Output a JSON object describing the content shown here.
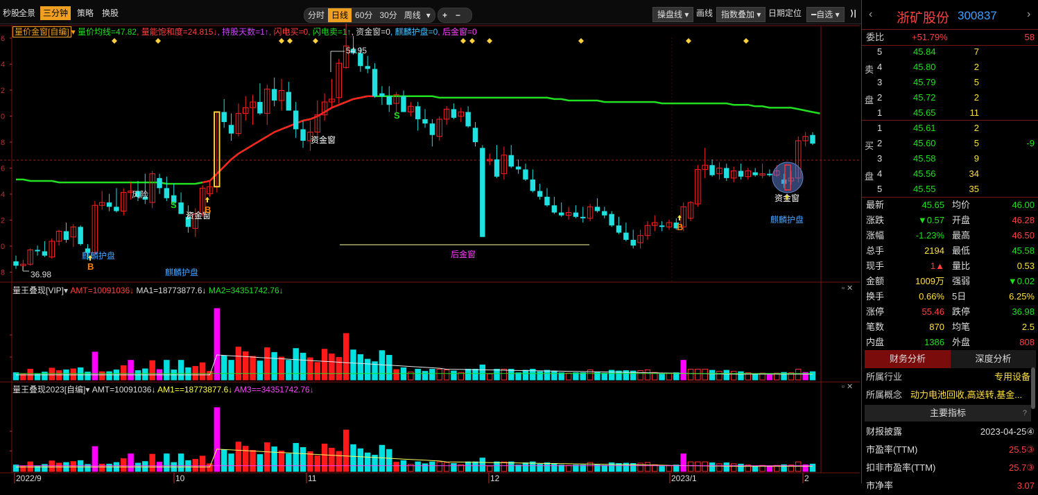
{
  "toolbar": {
    "left_items": [
      "秒股",
      "全景",
      "三分钟",
      "策略",
      "换股"
    ],
    "active_item": "三分钟",
    "periods": [
      "分时",
      "日线",
      "60分",
      "30分",
      "周线"
    ],
    "active_period": "日线",
    "period_dropdown_arrow": "▾",
    "plus": "+",
    "minus": "−",
    "right_items": [
      "操盘线",
      "画线",
      "指数叠加",
      "日期定位",
      "自选"
    ],
    "collapse_glyph": "⟩|"
  },
  "main_indicator": {
    "name": "量价金窗[自编]",
    "items": [
      {
        "text": "量价均线=47.82",
        "color": "#20e020"
      },
      {
        "text": "量能饱和度=24.815↓",
        "color": "#ff4040"
      },
      {
        "text": "持股天数=1↑",
        "color": "#d040ff"
      },
      {
        "text": "闪电买=0",
        "color": "#ff4040"
      },
      {
        "text": "闪电卖=1↑",
        "color": "#20e020"
      },
      {
        "text": "资金窗=0",
        "color": "#dddddd"
      },
      {
        "text": "麒麟护盘=0",
        "color": "#40c0ff"
      },
      {
        "text": "后金窗=0",
        "color": "#ff40ff"
      }
    ],
    "y_ticks": [
      "6",
      "4",
      "2",
      "0",
      "8",
      "6",
      "4",
      "2",
      "0",
      "8"
    ],
    "price_high": "54.95",
    "price_low": "36.98",
    "annotations": [
      {
        "text": "风险",
        "color": "#dddddd"
      },
      {
        "text": "资金窗",
        "color": "#ffffff"
      },
      {
        "text": "资金窗",
        "color": "#ffffff"
      },
      {
        "text": "资金窗",
        "color": "#ffffff"
      },
      {
        "text": "麒麟护盘",
        "color": "#40a0ff"
      },
      {
        "text": "麒麟护盘",
        "color": "#40a0ff"
      },
      {
        "text": "麒麟护盘",
        "color": "#40a0ff"
      },
      {
        "text": "后金窗",
        "color": "#ff40ff"
      },
      {
        "text": "B",
        "color": "#ff8000"
      },
      {
        "text": "B",
        "color": "#ff8000"
      },
      {
        "text": "B",
        "color": "#ff8000"
      },
      {
        "text": "S",
        "color": "#20e020"
      },
      {
        "text": "S",
        "color": "#20e020"
      }
    ]
  },
  "sub1": {
    "name": "量王叠现[VIP]",
    "items": [
      {
        "text": "AMT=10091036↓",
        "color": "#ff4040"
      },
      {
        "text": "MA1=18773877.6↓",
        "color": "#dddddd"
      },
      {
        "text": "MA2=34351742.76↓",
        "color": "#20e020"
      }
    ]
  },
  "sub2": {
    "name": "量王叠现2023[自编]",
    "items": [
      {
        "text": "AMT=10091036↓",
        "color": "#dddddd"
      },
      {
        "text": "AM1==18773877.6↓",
        "color": "#ffff40"
      },
      {
        "text": "AM3==34351742.76↓",
        "color": "#ff40ff"
      }
    ]
  },
  "x_axis": [
    "2022/9",
    "10",
    "11",
    "12",
    "2023/1",
    "2"
  ],
  "stock": {
    "name": "浙矿股份",
    "code": "300837",
    "weibi_label": "委比",
    "weibi_value": "+51.79%",
    "weibi_count": "58",
    "sell_label": [
      "卖",
      "盘"
    ],
    "buy_label": [
      "买",
      "盘"
    ],
    "sells": [
      {
        "level": "5",
        "price": "45.84",
        "vol": "7",
        "extra": ""
      },
      {
        "level": "4",
        "price": "45.80",
        "vol": "2",
        "extra": ""
      },
      {
        "level": "3",
        "price": "45.79",
        "vol": "5",
        "extra": ""
      },
      {
        "level": "2",
        "price": "45.72",
        "vol": "2",
        "extra": ""
      },
      {
        "level": "1",
        "price": "45.65",
        "vol": "11",
        "extra": ""
      }
    ],
    "buys": [
      {
        "level": "1",
        "price": "45.61",
        "vol": "2",
        "extra": ""
      },
      {
        "level": "2",
        "price": "45.60",
        "vol": "5",
        "extra": "-9"
      },
      {
        "level": "3",
        "price": "45.58",
        "vol": "9",
        "extra": ""
      },
      {
        "level": "4",
        "price": "45.56",
        "vol": "34",
        "extra": ""
      },
      {
        "level": "5",
        "price": "45.55",
        "vol": "35",
        "extra": ""
      }
    ],
    "quotes": [
      {
        "l1": "最新",
        "v1": "45.65",
        "c1": "#20e020",
        "l2": "均价",
        "v2": "46.00",
        "c2": "#20e020"
      },
      {
        "l1": "涨跌",
        "v1": "▼0.57",
        "c1": "#20e020",
        "l2": "开盘",
        "v2": "46.28",
        "c2": "#ff4040"
      },
      {
        "l1": "涨幅",
        "v1": "-1.23%",
        "c1": "#20e020",
        "l2": "最高",
        "v2": "46.50",
        "c2": "#ff4040"
      },
      {
        "l1": "总手",
        "v1": "2194",
        "c1": "#ffe040",
        "l2": "最低",
        "v2": "45.58",
        "c2": "#20e020"
      },
      {
        "l1": "现手",
        "v1": "1▲",
        "c1": "#ff4040",
        "l2": "量比",
        "v2": "0.53",
        "c2": "#ffe040"
      },
      {
        "l1": "金额",
        "v1": "1009万",
        "c1": "#ffe040",
        "l2": "强弱",
        "v2": "▼0.02",
        "c2": "#20e020"
      },
      {
        "l1": "换手",
        "v1": "0.66%",
        "c1": "#ffe040",
        "l2": "5日",
        "v2": "6.25%",
        "c2": "#ffe040"
      },
      {
        "l1": "涨停",
        "v1": "55.46",
        "c1": "#ff4040",
        "l2": "跌停",
        "v2": "36.98",
        "c2": "#20e020"
      },
      {
        "l1": "笔数",
        "v1": "870",
        "c1": "#ffe040",
        "l2": "均笔",
        "v2": "2.5",
        "c2": "#ffe040"
      },
      {
        "l1": "内盘",
        "v1": "1386",
        "c1": "#20e020",
        "l2": "外盘",
        "v2": "808",
        "c2": "#ff4040"
      }
    ],
    "tabs": [
      "财务分析",
      "深度分析"
    ],
    "industry_label": "所属行业",
    "industry_value": "专用设备",
    "concept_label": "所属概念",
    "concept_value": "动力电池回收,高送转,基金...",
    "main_index_title": "主要指标",
    "help": "?",
    "metrics": [
      {
        "label": "财报披露",
        "value": "2023-04-25④",
        "color": "#dddddd"
      },
      {
        "label": "市盈率(TTM)",
        "value": "25.5③",
        "color": "#ff4040"
      },
      {
        "label": "扣非市盈率(TTM)",
        "value": "25.7③",
        "color": "#ff4040"
      },
      {
        "label": "市净率",
        "value": "3.07",
        "color": "#ff4040"
      }
    ]
  },
  "colors": {
    "up": "#ff2020",
    "down": "#20e0e0",
    "ma": "#20e020",
    "mag": "#ff00ff"
  },
  "chart_data": {
    "type": "candlestick",
    "price_axis_ticks": [
      "6",
      "4",
      "2",
      "0",
      "8",
      "6",
      "4",
      "2",
      "0",
      "8"
    ],
    "high_label": 54.95,
    "low_label": 36.98,
    "ohlc": [
      [
        37.5,
        37.9,
        36.98,
        37.2
      ],
      [
        37.2,
        37.6,
        36.9,
        37.3
      ],
      [
        37.3,
        38.4,
        37.2,
        38.3
      ],
      [
        38.3,
        38.6,
        37.9,
        38.2
      ],
      [
        38.2,
        38.9,
        37.8,
        37.9
      ],
      [
        37.8,
        39.1,
        37.7,
        38.9
      ],
      [
        38.9,
        39.7,
        38.6,
        39.6
      ],
      [
        39.6,
        40.2,
        38.8,
        39.0
      ],
      [
        39.2,
        40.1,
        38.5,
        39.9
      ],
      [
        39.9,
        40.0,
        38.6,
        38.7
      ],
      [
        38.4,
        38.7,
        37.6,
        38.1
      ],
      [
        38.1,
        41.7,
        38.0,
        41.4
      ],
      [
        41.4,
        42.4,
        41.1,
        41.6
      ],
      [
        41.6,
        42.2,
        41.0,
        41.3
      ],
      [
        41.3,
        42.6,
        40.9,
        41.0
      ],
      [
        41.0,
        42.6,
        40.7,
        42.3
      ],
      [
        42.3,
        43.0,
        41.8,
        42.4
      ],
      [
        42.4,
        43.1,
        41.7,
        42.0
      ],
      [
        42.0,
        43.6,
        41.5,
        41.8
      ],
      [
        41.6,
        43.8,
        41.2,
        43.6
      ],
      [
        43.3,
        43.6,
        42.2,
        42.6
      ],
      [
        42.6,
        43.4,
        41.7,
        41.9
      ],
      [
        42.1,
        42.9,
        41.4,
        41.6
      ],
      [
        41.6,
        42.3,
        40.8,
        40.8
      ],
      [
        40.6,
        41.4,
        39.5,
        39.9
      ],
      [
        39.8,
        41.2,
        39.2,
        40.8
      ],
      [
        40.8,
        42.8,
        40.6,
        42.6
      ],
      [
        42.2,
        43.1,
        42.0,
        42.7
      ],
      [
        42.7,
        47.9,
        42.3,
        47.9
      ],
      [
        47.9,
        48.8,
        46.8,
        47.2
      ],
      [
        47.0,
        47.8,
        45.9,
        46.4
      ],
      [
        46.4,
        48.5,
        46.2,
        47.8
      ],
      [
        47.8,
        49.0,
        47.3,
        48.2
      ],
      [
        48.2,
        49.1,
        47.0,
        48.6
      ],
      [
        48.6,
        49.9,
        47.7,
        47.8
      ],
      [
        47.8,
        49.8,
        47.0,
        49.5
      ],
      [
        49.5,
        50.3,
        48.3,
        48.7
      ],
      [
        48.7,
        50.2,
        48.0,
        49.4
      ],
      [
        49.3,
        50.0,
        48.2,
        48.0
      ],
      [
        48.0,
        48.6,
        46.1,
        46.7
      ],
      [
        46.7,
        47.3,
        45.4,
        45.9
      ],
      [
        45.9,
        47.3,
        45.2,
        46.5
      ],
      [
        46.5,
        48.7,
        46.2,
        47.7
      ],
      [
        47.7,
        49.2,
        47.3,
        48.6
      ],
      [
        48.6,
        50.2,
        48.2,
        48.8
      ],
      [
        48.9,
        51.6,
        48.5,
        51.3
      ],
      [
        51.0,
        54.95,
        50.9,
        52.5
      ],
      [
        52.3,
        53.2,
        51.9,
        52.0
      ],
      [
        52.0,
        52.4,
        50.7,
        51.1
      ],
      [
        51.1,
        51.8,
        50.6,
        50.9
      ],
      [
        50.9,
        51.3,
        48.9,
        49.0
      ],
      [
        49.2,
        49.7,
        48.4,
        49.0
      ],
      [
        49.0,
        49.7,
        47.9,
        48.4
      ],
      [
        48.5,
        49.3,
        47.8,
        49.1
      ],
      [
        49.0,
        49.4,
        47.9,
        47.9
      ],
      [
        47.9,
        48.6,
        47.6,
        48.3
      ],
      [
        48.3,
        48.6,
        46.6,
        47.4
      ],
      [
        47.4,
        48.1,
        46.8,
        47.1
      ],
      [
        47.1,
        47.4,
        45.5,
        46.3
      ],
      [
        46.2,
        47.6,
        45.9,
        47.4
      ],
      [
        47.4,
        48.3,
        47.0,
        48.1
      ],
      [
        48.1,
        48.5,
        47.4,
        47.5
      ],
      [
        47.6,
        48.2,
        47.2,
        47.9
      ],
      [
        47.9,
        48.3,
        46.8,
        46.9
      ],
      [
        46.8,
        47.2,
        45.5,
        45.8
      ],
      [
        45.4,
        45.6,
        39.2,
        39.2
      ],
      [
        44.5,
        45.0,
        44.2,
        44.6
      ],
      [
        44.6,
        45.6,
        43.3,
        43.4
      ],
      [
        43.6,
        45.5,
        43.2,
        44.9
      ],
      [
        44.9,
        45.6,
        44.0,
        44.1
      ],
      [
        44.1,
        44.6,
        43.6,
        43.9
      ],
      [
        43.9,
        44.3,
        43.1,
        43.2
      ],
      [
        43.2,
        43.9,
        42.3,
        42.4
      ],
      [
        42.4,
        42.9,
        41.8,
        42.0
      ],
      [
        42.0,
        42.6,
        41.3,
        41.4
      ],
      [
        41.4,
        42.0,
        40.8,
        40.9
      ],
      [
        40.9,
        41.6,
        40.6,
        40.7
      ],
      [
        40.7,
        41.3,
        40.4,
        40.9
      ],
      [
        40.9,
        41.4,
        40.5,
        40.6
      ],
      [
        40.6,
        41.3,
        40.2,
        40.5
      ],
      [
        40.5,
        41.5,
        40.3,
        41.3
      ],
      [
        41.3,
        41.9,
        40.9,
        41.0
      ],
      [
        41.0,
        41.3,
        40.5,
        40.7
      ],
      [
        40.8,
        41.0,
        39.9,
        40.0
      ],
      [
        40.0,
        40.6,
        39.4,
        39.5
      ],
      [
        39.5,
        40.2,
        38.9,
        39.0
      ],
      [
        39.0,
        39.7,
        38.4,
        38.6
      ],
      [
        38.8,
        39.7,
        38.4,
        39.3
      ],
      [
        39.3,
        40.3,
        39.0,
        40.0
      ],
      [
        40.0,
        40.7,
        39.6,
        40.2
      ],
      [
        40.0,
        40.3,
        39.6,
        39.9
      ],
      [
        39.9,
        40.4,
        39.7,
        40.2
      ],
      [
        40.2,
        40.5,
        39.7,
        39.8
      ],
      [
        39.9,
        41.6,
        39.6,
        41.3
      ],
      [
        40.5,
        41.7,
        40.3,
        41.6
      ],
      [
        41.5,
        44.2,
        41.3,
        43.9
      ],
      [
        43.9,
        45.4,
        43.3,
        44.2
      ],
      [
        44.2,
        44.6,
        43.4,
        43.5
      ],
      [
        43.6,
        44.4,
        43.2,
        44.0
      ],
      [
        44.0,
        44.3,
        43.1,
        43.3
      ],
      [
        43.3,
        44.1,
        43.0,
        43.8
      ],
      [
        43.8,
        44.3,
        43.2,
        43.4
      ],
      [
        43.4,
        44.0,
        43.2,
        43.8
      ],
      [
        43.7,
        44.0,
        43.4,
        43.5
      ],
      [
        43.5,
        44.3,
        43.3,
        43.6
      ],
      [
        43.6,
        43.9,
        43.4,
        43.5
      ],
      [
        43.5,
        44.2,
        43.4,
        43.8
      ],
      [
        43.2,
        43.6,
        42.6,
        42.9
      ],
      [
        43.1,
        43.8,
        42.8,
        43.3
      ],
      [
        43.3,
        46.2,
        43.0,
        45.9
      ],
      [
        45.9,
        46.5,
        45.5,
        46.2
      ],
      [
        46.3,
        46.5,
        45.6,
        45.7
      ]
    ],
    "ma_line": [
      43.2,
      43.2,
      43.1,
      43.1,
      43.1,
      43.1,
      43.0,
      43.0,
      43.0,
      43.0,
      43.0,
      43.0,
      43.0,
      43.0,
      43.0,
      43.0,
      43.0,
      43.0,
      43.0,
      43.0,
      43.0,
      42.9,
      42.9,
      42.9,
      42.9,
      42.9,
      43.0,
      43.1,
      43.6,
      44.1,
      44.6,
      45.0,
      45.3,
      45.6,
      45.9,
      46.2,
      46.5,
      46.7,
      46.9,
      47.1,
      47.3,
      47.4,
      47.6,
      47.9,
      48.2,
      48.4,
      48.6,
      48.8,
      48.9,
      49.0,
      49.0,
      49.0,
      49.0,
      49.0,
      49.0,
      49.0,
      49.0,
      49.0,
      49.0,
      48.9,
      48.9,
      48.9,
      48.9,
      48.9,
      48.9,
      48.9,
      48.9,
      48.9,
      48.9,
      48.9,
      48.9,
      48.9,
      48.9,
      48.9,
      48.9,
      48.8,
      48.8,
      48.7,
      48.7,
      48.7,
      48.7,
      48.7,
      48.6,
      48.6,
      48.6,
      48.6,
      48.6,
      48.6,
      48.6,
      48.6,
      48.5,
      48.5,
      48.5,
      48.5,
      48.5,
      48.5,
      48.5,
      48.5,
      48.5,
      48.5,
      48.4,
      48.4,
      48.4,
      48.3,
      48.3,
      48.2,
      48.2,
      48.2,
      48.2,
      48.1,
      48.0,
      47.9,
      47.8
    ],
    "amount_ma1": 18773877.6,
    "amount_ma2": 34351742.76,
    "amount_last": 10091036,
    "x_labels": [
      "2022/9",
      "10",
      "11",
      "12",
      "2023/1",
      "2"
    ]
  }
}
